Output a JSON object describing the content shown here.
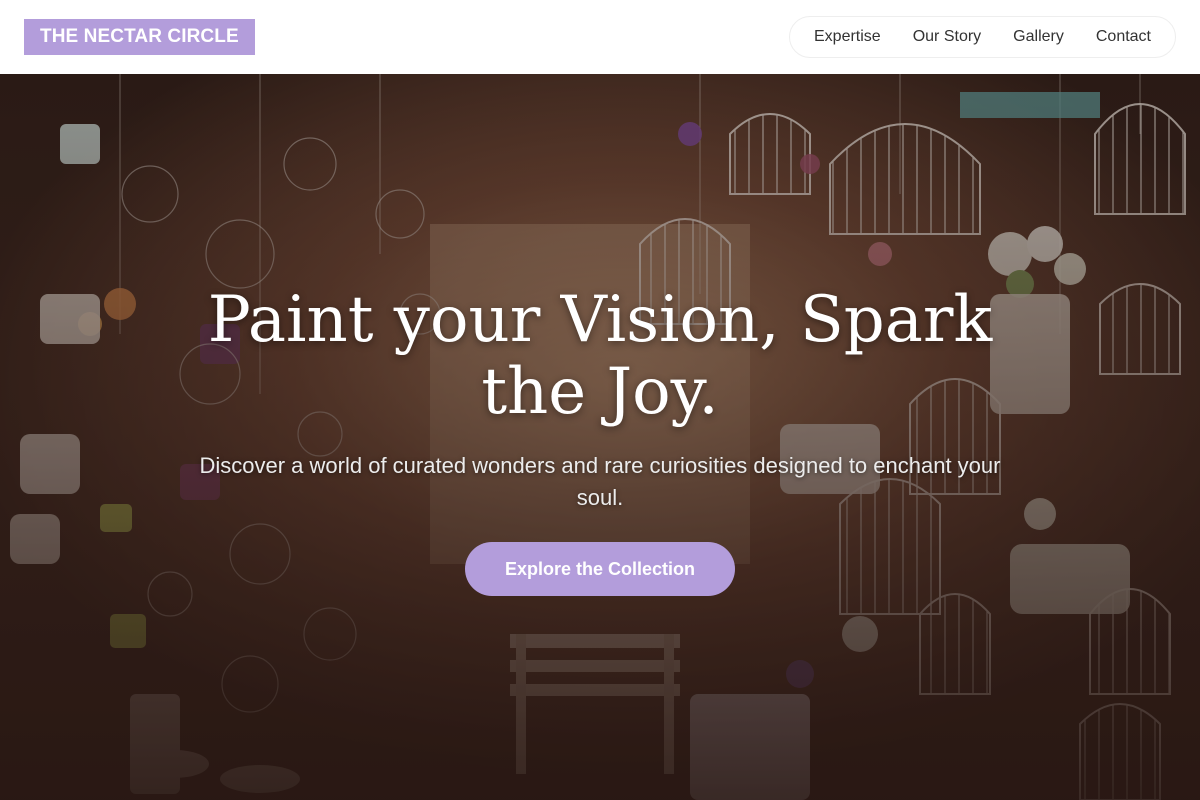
{
  "header": {
    "brand": "THE NECTAR CIRCLE",
    "nav": [
      {
        "label": "Expertise"
      },
      {
        "label": "Our Story"
      },
      {
        "label": "Gallery"
      },
      {
        "label": "Contact"
      }
    ]
  },
  "hero": {
    "title": "Paint your Vision, Spark the Joy.",
    "subtitle": "Discover a world of curated wonders and rare curiosities designed to enchant your soul.",
    "cta_label": "Explore the Collection"
  },
  "colors": {
    "accent": "#b39ddb",
    "header_background": "#ffffff",
    "nav_text": "#333333",
    "hero_text": "#ffffff"
  }
}
